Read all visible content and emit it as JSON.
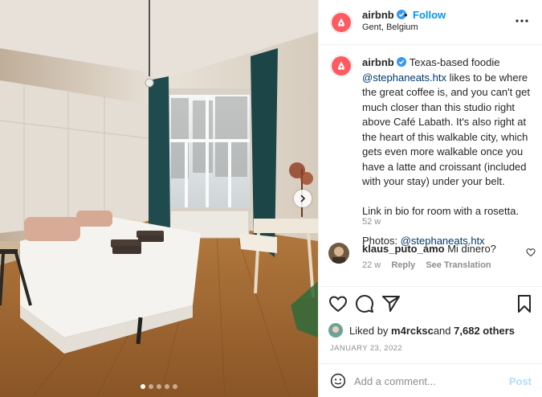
{
  "header": {
    "username": "airbnb",
    "separator": "•",
    "follow_label": "Follow",
    "location": "Gent, Belgium",
    "avatar_icon": "airbnb-logo-icon",
    "verified_icon": "verified-badge-icon",
    "more_icon": "more-options-icon"
  },
  "caption": {
    "username": "airbnb",
    "text_1": " Texas-based foodie ",
    "mention_1": "@stephaneats.htx",
    "text_2": " likes to be where the great coffee is, and you can't get much closer than this studio right above Café Labath. It's also right at the heart of this walkable city, which gets even more walkable once you have a latte and croissant (included with your stay) under your belt.",
    "paragraph_2": "Link in bio for room with a rosetta.",
    "photos_label": "Photos: ",
    "mention_2": "@stephaneats.htx",
    "time": "52 w"
  },
  "comment": {
    "username": "klaus_puto_amo",
    "text": " Mi dinero?",
    "time": "22 w",
    "reply_label": "Reply",
    "translation_label": "See Translation",
    "like_icon": "heart-outline-icon"
  },
  "actions": {
    "like_icon": "heart-outline-icon",
    "comment_icon": "comment-bubble-icon",
    "share_icon": "paper-plane-icon",
    "save_icon": "bookmark-icon"
  },
  "likes": {
    "prefix": "Liked by ",
    "user": "m4rcksc",
    "middle": " and ",
    "others": "7,682 others"
  },
  "date": "JANUARY 23, 2022",
  "add_comment": {
    "placeholder": "Add a comment...",
    "post_label": "Post",
    "emoji_icon": "smiley-icon"
  },
  "carousel": {
    "total_slides": 5,
    "active_slide": 1,
    "next_icon": "chevron-right-icon"
  },
  "colors": {
    "brand": "#ff5a5f",
    "link": "#00376b",
    "follow": "#0095f6",
    "post_disabled": "#b3dbff",
    "muted": "#8e8e8e"
  }
}
